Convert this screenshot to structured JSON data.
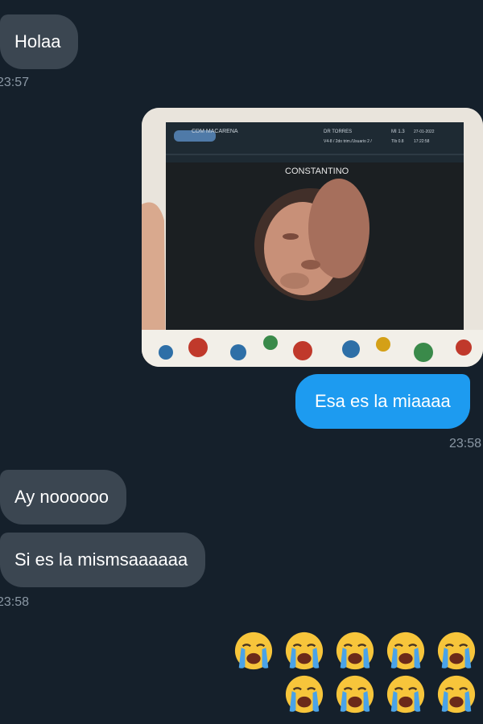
{
  "messages": [
    {
      "text": "Holaa",
      "side": "in"
    },
    {
      "text": "Esa es la miaaaa",
      "side": "out"
    },
    {
      "text": "Ay noooooo",
      "side": "in"
    },
    {
      "text": "Si es la mismsaaaaaa",
      "side": "in"
    }
  ],
  "timestamps": [
    "23:57",
    "23:58",
    "23:58"
  ],
  "photo": {
    "header_left": "CDM MACARENA",
    "header_mid_1": "DR TORRES",
    "header_mid_2": "V4-8 / 2do trim./Usuario 2 /",
    "header_right_1": "MI 1.3",
    "header_right_2": "TIb 0.8",
    "header_date": "27-01-2022",
    "header_time": "17:22:58",
    "overlay_name": "CONSTANTINO"
  },
  "reaction": {
    "emoji": "loudly-crying-face",
    "count": 9
  },
  "colors": {
    "background": "#15202b",
    "incoming": "#3b4651",
    "outgoing": "#1d9bf0"
  }
}
